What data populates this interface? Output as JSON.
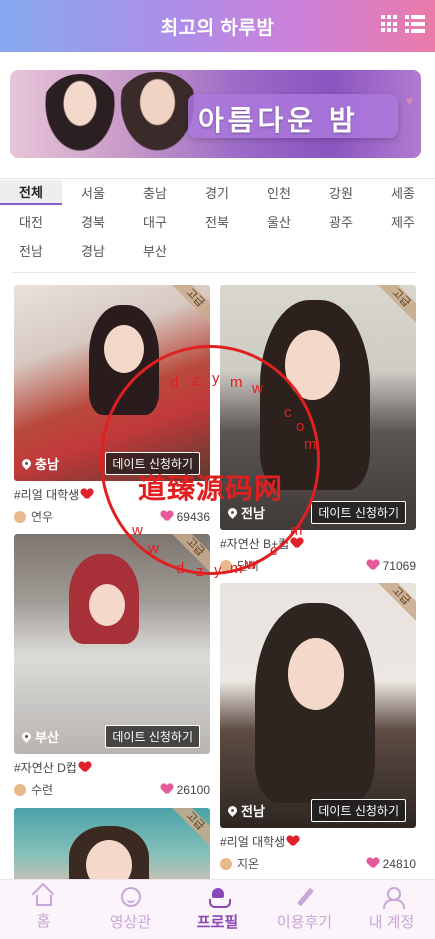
{
  "header": {
    "title": "최고의 하루밤",
    "grid_icon": "grid-view-icon",
    "list_icon": "list-view-icon"
  },
  "banner": {
    "text": "아름다운 밤"
  },
  "regions": {
    "row1": [
      "전체",
      "서울",
      "충남",
      "경기",
      "인천",
      "강원",
      "세종"
    ],
    "row2": [
      "대전",
      "경북",
      "대구",
      "전북",
      "울산",
      "광주",
      "제주"
    ],
    "row3": [
      "전남",
      "경남",
      "부산"
    ],
    "active": "전체"
  },
  "cards": [
    {
      "tag": "고급",
      "location": "충남",
      "date_button": "데이트 신청하기",
      "title": "#리얼 대학생",
      "user": "연우",
      "likes": "69436"
    },
    {
      "tag": "고급",
      "location": "전남",
      "date_button": "데이트 신청하기",
      "title": "#자연산 B+컵",
      "user": "단비",
      "likes": "71069"
    },
    {
      "tag": "고급",
      "location": "부산",
      "date_button": "데이트 신청하기",
      "title": "#자연산 D컵",
      "user": "수련",
      "likes": "26100"
    },
    {
      "tag": "고급",
      "location": "전남",
      "date_button": "데이트 신청하기",
      "title": "#리얼 대학생",
      "user": "지온",
      "likes": "24810"
    },
    {
      "tag": "고급"
    }
  ],
  "watermark": {
    "main": "道臻源码网",
    "chars": [
      "d",
      "z",
      "y",
      "m",
      "w",
      "c",
      "o",
      "m",
      "w",
      "w",
      "d",
      "z",
      "y",
      "m",
      "w",
      "c",
      "m"
    ]
  },
  "bottom_nav": [
    {
      "label": "홈",
      "icon": "home-icon"
    },
    {
      "label": "영상관",
      "icon": "smile-icon"
    },
    {
      "label": "프로필",
      "icon": "hand-heart-icon",
      "active": true
    },
    {
      "label": "이용후기",
      "icon": "pen-icon"
    },
    {
      "label": "내 계정",
      "icon": "user-icon"
    }
  ],
  "colors": {
    "accent": "#8a48b8",
    "heart_red": "#e0202a",
    "heart_pink": "#e45a9a",
    "watermark": "#e02020"
  }
}
